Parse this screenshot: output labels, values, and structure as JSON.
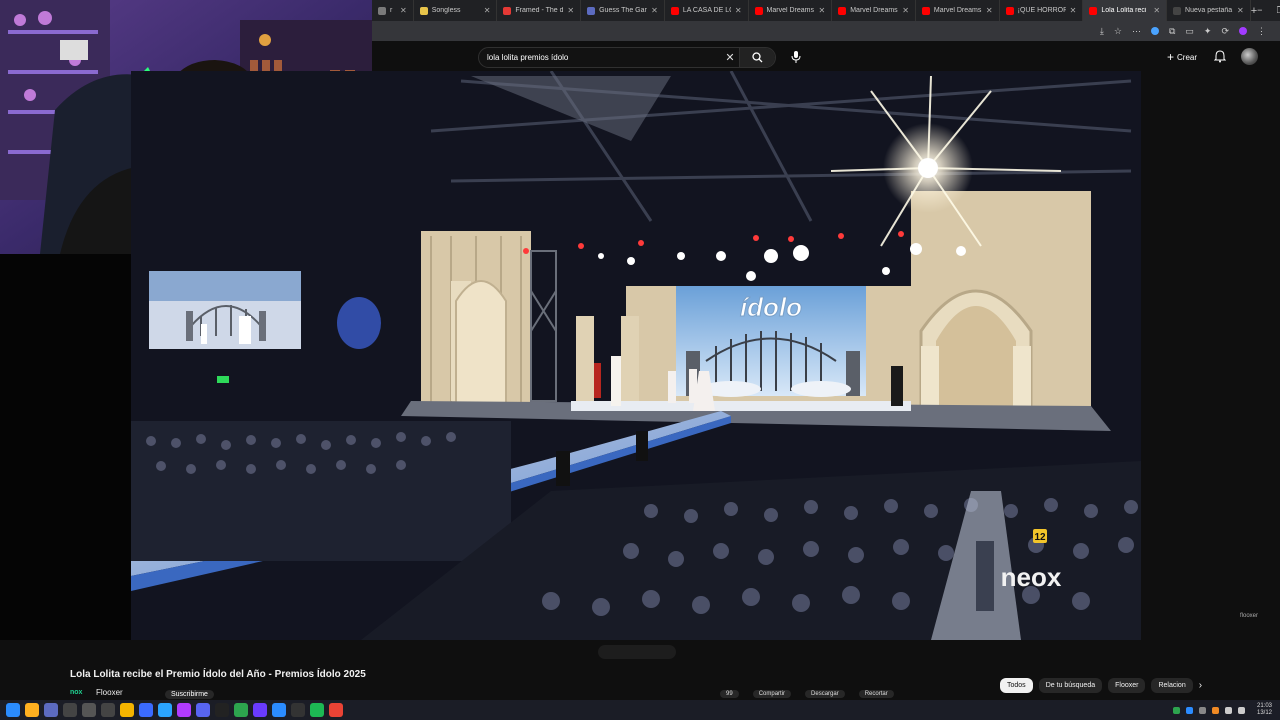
{
  "browser": {
    "tabs": [
      {
        "title": "r",
        "color": "#7a7a7a"
      },
      {
        "title": "Songless",
        "color": "#e8c44a"
      },
      {
        "title": "Framed - The d",
        "color": "#e53935"
      },
      {
        "title": "Guess The Gam",
        "color": "#5c6bc0"
      },
      {
        "title": "LA CASA DE LO",
        "color": "#ff0000"
      },
      {
        "title": "Marvel Dreams",
        "color": "#ff0000"
      },
      {
        "title": "Marvel Dreams",
        "color": "#ff0000"
      },
      {
        "title": "Marvel Dreams",
        "color": "#ff0000"
      },
      {
        "title": "¡QUE HORROR!",
        "color": "#ff0000"
      },
      {
        "title": "Lola Lolita reci",
        "color": "#ff0000",
        "active": true
      },
      {
        "title": "Nueva pestaña",
        "color": "#444444"
      }
    ],
    "new_tab_glyph": "+",
    "window_controls": [
      "−",
      "❐",
      "✕"
    ]
  },
  "youtube": {
    "search_query": "lola lolita premios ídolo",
    "create_label": "Crear",
    "video_watermark": "flooxer",
    "network_logo_number": "12",
    "network_logo_text": "neox",
    "stage_logo_text": "ídolo"
  },
  "video_info": {
    "title": "Lola Lolita recibe el Premio Ídolo del Año - Premios Ídolo 2025",
    "channel": "Flooxer",
    "channel_logo": "nox",
    "subscribe_label": "Suscribirme",
    "actions": [
      "99",
      "Compartir",
      "Descargar",
      "Recortar"
    ]
  },
  "chips": [
    {
      "label": "Todos",
      "active": true
    },
    {
      "label": "De tu búsqueda",
      "active": false
    },
    {
      "label": "Flooxer",
      "active": false
    },
    {
      "label": "Relacion",
      "active": false
    }
  ],
  "taskbar": {
    "time": "21:03",
    "date": "13/12",
    "apps": [
      {
        "icon": "windows-icon",
        "color": "#2b8cff"
      },
      {
        "icon": "search-icon",
        "color": "#ffb020"
      },
      {
        "icon": "vivaldi-icon",
        "color": "#5c6bc0"
      },
      {
        "icon": "app-4k-icon",
        "color": "#444"
      },
      {
        "icon": "app-circle-icon",
        "color": "#555"
      },
      {
        "icon": "window-icon",
        "color": "#444"
      },
      {
        "icon": "files-icon",
        "color": "#f5b400"
      },
      {
        "icon": "stream-icon",
        "color": "#3b6bff"
      },
      {
        "icon": "check-icon",
        "color": "#2ba4ff"
      },
      {
        "icon": "music-icon",
        "color": "#b03bff"
      },
      {
        "icon": "discord-icon",
        "color": "#5865f2"
      },
      {
        "icon": "tiktok-icon",
        "color": "#222"
      },
      {
        "icon": "grid-icon",
        "color": "#2da44e"
      },
      {
        "icon": "chat-icon",
        "color": "#6a3bff"
      },
      {
        "icon": "c-icon",
        "color": "#2b8cff"
      },
      {
        "icon": "obs-icon",
        "color": "#333"
      },
      {
        "icon": "spotify-icon",
        "color": "#1db954"
      },
      {
        "icon": "chrome-icon",
        "color": "#ea4335"
      }
    ]
  }
}
